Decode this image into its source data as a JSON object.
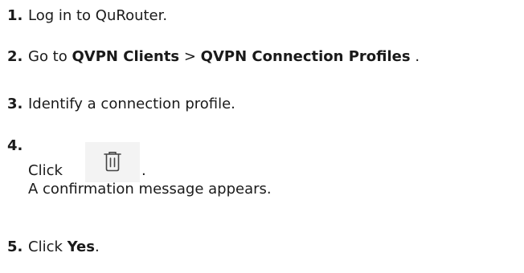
{
  "steps": [
    {
      "number": "1.",
      "text": "Log in to QuRouter."
    },
    {
      "number": "2.",
      "prefix": "Go to ",
      "menu1": "QVPN Clients",
      "sep": " > ",
      "menu2": "QVPN Connection Profiles",
      "suffix": " ."
    },
    {
      "number": "3.",
      "text": "Identify a connection profile."
    },
    {
      "number": "4.",
      "click_label": "Click",
      "icon": "trash-icon",
      "period": ".",
      "result": "A confirmation message appears."
    },
    {
      "number": "5.",
      "prefix": "Click ",
      "button": "Yes",
      "suffix": "."
    }
  ]
}
